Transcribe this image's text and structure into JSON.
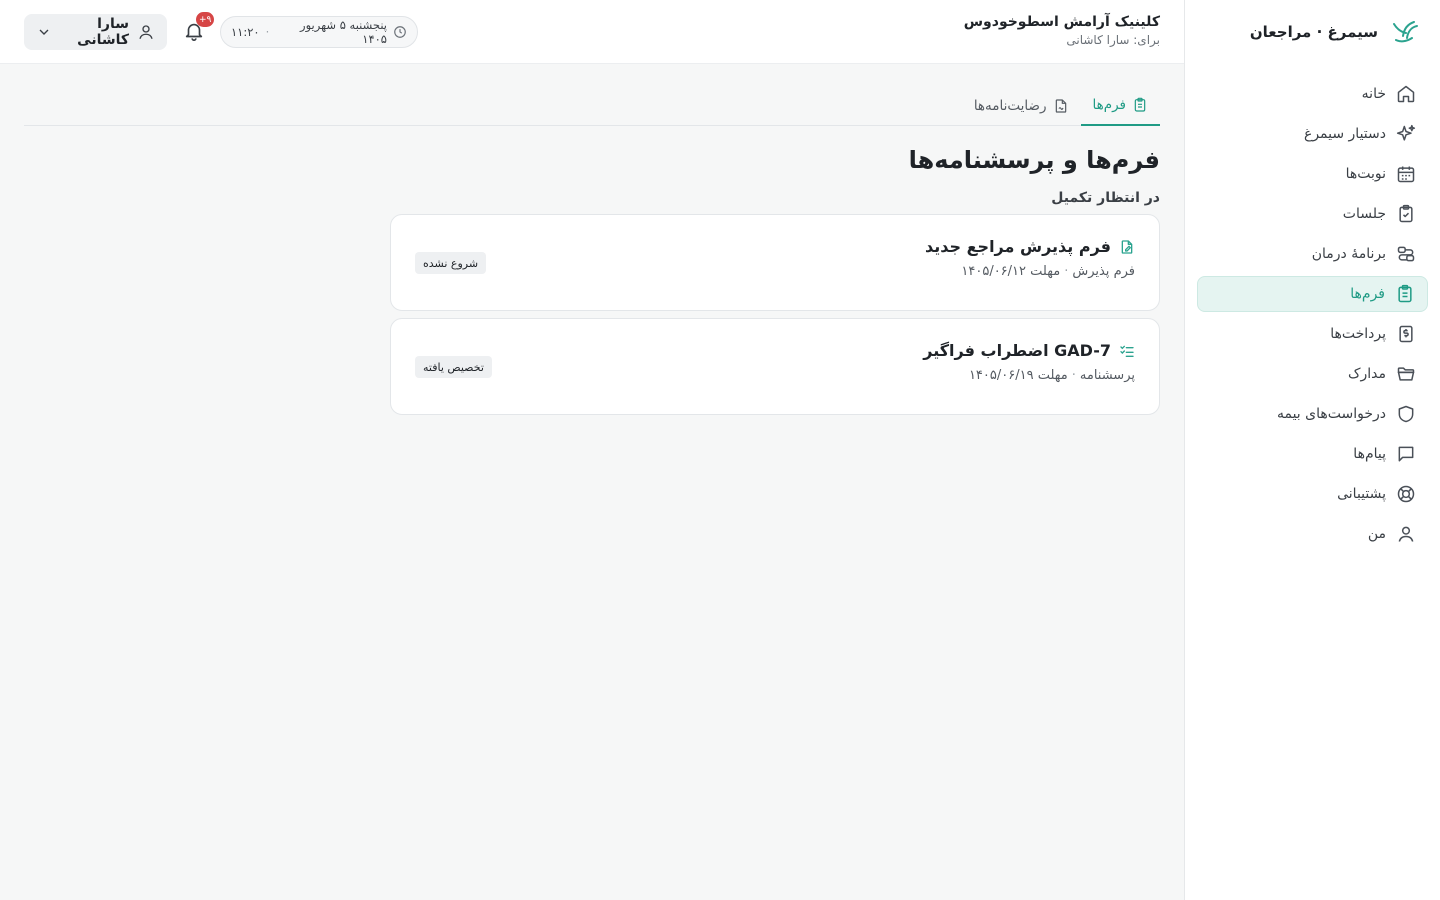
{
  "brand": {
    "name": "سیمرغ · مراجعان",
    "logo_icon": "simorgh-logo"
  },
  "sidebar": {
    "items": [
      {
        "label": "خانه",
        "icon": "home-icon",
        "active": false
      },
      {
        "label": "دستیار سیمرغ",
        "icon": "sparkles-icon",
        "active": false
      },
      {
        "label": "نوبت‌ها",
        "icon": "calendar-icon",
        "active": false
      },
      {
        "label": "جلسات",
        "icon": "clipboard-check-icon",
        "active": false
      },
      {
        "label": "برنامهٔ درمان",
        "icon": "route-icon",
        "active": false
      },
      {
        "label": "فرم‌ها",
        "icon": "clipboard-list-icon",
        "active": true
      },
      {
        "label": "پرداخت‌ها",
        "icon": "dollar-receipt-icon",
        "active": false
      },
      {
        "label": "مدارک",
        "icon": "folder-icon",
        "active": false
      },
      {
        "label": "درخواست‌های بیمه",
        "icon": "shield-icon",
        "active": false
      },
      {
        "label": "پیام‌ها",
        "icon": "message-icon",
        "active": false
      },
      {
        "label": "پشتیبانی",
        "icon": "lifebuoy-icon",
        "active": false
      },
      {
        "label": "من",
        "icon": "user-icon",
        "active": false
      }
    ]
  },
  "header": {
    "clinic_name": "کلینیک آرامش اسطوخودوس",
    "clinic_sub": "برای: سارا کاشانی",
    "date": "پنجشنبه ۵ شهریور ۱۴۰۵",
    "time": "۱۱:۲۰",
    "notification_count": "۹+",
    "user_name": "سارا کاشانی"
  },
  "tabs": [
    {
      "label": "فرم‌ها",
      "icon": "clipboard-list-icon",
      "active": true
    },
    {
      "label": "رضایت‌نامه‌ها",
      "icon": "file-signature-icon",
      "active": false
    }
  ],
  "main": {
    "title": "فرم‌ها و پرسشنامه‌ها",
    "section_label": "در انتظار تکمیل",
    "cards": [
      {
        "title": "فرم پذیرش مراجع جدید",
        "icon": "file-edit-icon",
        "type": "فرم پذیرش",
        "due": "مهلت ۱۴۰۵/۰۶/۱۲",
        "status": "شروع نشده"
      },
      {
        "title": "GAD-7 اضطراب فراگیر",
        "icon": "checklist-icon",
        "type": "پرسشنامه",
        "due": "مهلت ۱۴۰۵/۰۶/۱۹",
        "status": "تخصیص یافته"
      }
    ]
  },
  "colors": {
    "accent": "#1f9b85",
    "badge": "#d64545"
  }
}
